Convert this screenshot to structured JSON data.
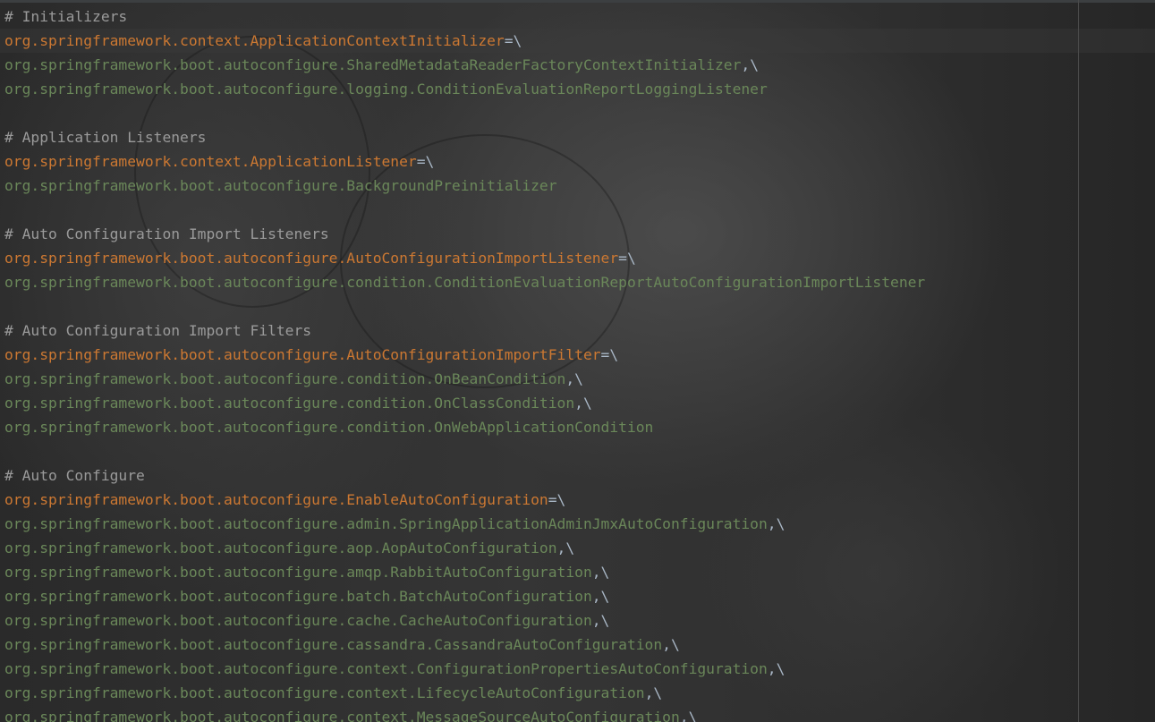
{
  "editor": {
    "lines": [
      {
        "type": "comment",
        "text": "# Initializers"
      },
      {
        "type": "key",
        "key": "org.springframework.context.ApplicationContextInitializer",
        "op": "=\\"
      },
      {
        "type": "value",
        "text": "org.springframework.boot.autoconfigure.SharedMetadataReaderFactoryContextInitializer",
        "cont": ",\\"
      },
      {
        "type": "value",
        "text": "org.springframework.boot.autoconfigure.logging.ConditionEvaluationReportLoggingListener",
        "cont": ""
      },
      {
        "type": "blank"
      },
      {
        "type": "comment",
        "text": "# Application Listeners"
      },
      {
        "type": "key",
        "key": "org.springframework.context.ApplicationListener",
        "op": "=\\"
      },
      {
        "type": "value",
        "text": "org.springframework.boot.autoconfigure.BackgroundPreinitializer",
        "cont": ""
      },
      {
        "type": "blank"
      },
      {
        "type": "comment",
        "text": "# Auto Configuration Import Listeners"
      },
      {
        "type": "key",
        "key": "org.springframework.boot.autoconfigure.AutoConfigurationImportListener",
        "op": "=\\"
      },
      {
        "type": "value",
        "text": "org.springframework.boot.autoconfigure.condition.ConditionEvaluationReportAutoConfigurationImportListener",
        "cont": ""
      },
      {
        "type": "blank"
      },
      {
        "type": "comment",
        "text": "# Auto Configuration Import Filters"
      },
      {
        "type": "key",
        "key": "org.springframework.boot.autoconfigure.AutoConfigurationImportFilter",
        "op": "=\\"
      },
      {
        "type": "value",
        "text": "org.springframework.boot.autoconfigure.condition.OnBeanCondition",
        "cont": ",\\"
      },
      {
        "type": "value",
        "text": "org.springframework.boot.autoconfigure.condition.OnClassCondition",
        "cont": ",\\"
      },
      {
        "type": "value",
        "text": "org.springframework.boot.autoconfigure.condition.OnWebApplicationCondition",
        "cont": ""
      },
      {
        "type": "blank"
      },
      {
        "type": "comment",
        "text": "# Auto Configure"
      },
      {
        "type": "key",
        "key": "org.springframework.boot.autoconfigure.EnableAutoConfiguration",
        "op": "=\\"
      },
      {
        "type": "value",
        "text": "org.springframework.boot.autoconfigure.admin.SpringApplicationAdminJmxAutoConfiguration",
        "cont": ",\\"
      },
      {
        "type": "value",
        "text": "org.springframework.boot.autoconfigure.aop.AopAutoConfiguration",
        "cont": ",\\"
      },
      {
        "type": "value",
        "text": "org.springframework.boot.autoconfigure.amqp.RabbitAutoConfiguration",
        "cont": ",\\"
      },
      {
        "type": "value",
        "text": "org.springframework.boot.autoconfigure.batch.BatchAutoConfiguration",
        "cont": ",\\"
      },
      {
        "type": "value",
        "text": "org.springframework.boot.autoconfigure.cache.CacheAutoConfiguration",
        "cont": ",\\"
      },
      {
        "type": "value",
        "text": "org.springframework.boot.autoconfigure.cassandra.CassandraAutoConfiguration",
        "cont": ",\\"
      },
      {
        "type": "value",
        "text": "org.springframework.boot.autoconfigure.context.ConfigurationPropertiesAutoConfiguration",
        "cont": ",\\"
      },
      {
        "type": "value",
        "text": "org.springframework.boot.autoconfigure.context.LifecycleAutoConfiguration",
        "cont": ",\\"
      },
      {
        "type": "value",
        "text": "org.springframework.boot.autoconfigure.context.MessageSourceAutoConfiguration",
        "cont": ",\\"
      }
    ]
  },
  "colors": {
    "background": "#2b2b2b",
    "comment": "#9a9a9a",
    "key": "#cc7832",
    "value": "#6a8759",
    "operator": "#a9b7c6"
  }
}
